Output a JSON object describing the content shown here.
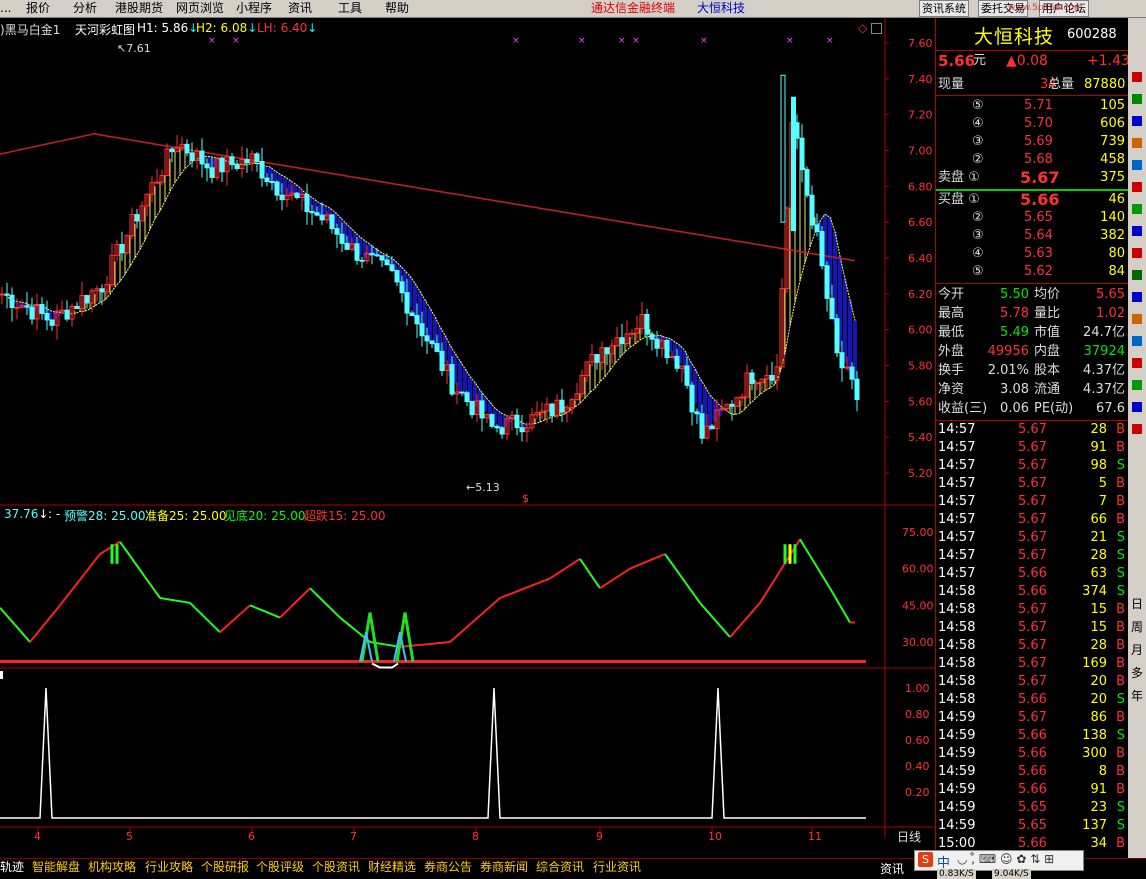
{
  "menu": {
    "items": [
      "报价",
      "分析",
      "港股期货",
      "网页浏览",
      "小程序",
      "资讯",
      "工具",
      "帮助"
    ],
    "promo1": "通达信金融终端",
    "promo2": "大恒科技",
    "buttons": [
      "资讯系统",
      "委托交易",
      "用户论坛"
    ],
    "site": "www.5p168.com"
  },
  "chart": {
    "indicator_name": "黑马白金1",
    "indicator2": "天河彩虹图",
    "h1": "H1: 5.86",
    "h2": "H2: 6.08",
    "lh": "LH: 6.40",
    "hi_label": "7.61",
    "lo_label": "5.13",
    "price_ticks": [
      "7.60",
      "7.40",
      "7.20",
      "7.00",
      "6.80",
      "6.60",
      "6.40",
      "6.20",
      "6.00",
      "5.80",
      "5.60",
      "5.40",
      "5.20"
    ],
    "osc_header": {
      "value": "37.76",
      "sep": ": -",
      "warn": "预警28: 25.00",
      "prep": "准备25: 25.00",
      "bottom": "见底20: 25.00",
      "oversold": "超跌15: 25.00"
    },
    "osc_ticks": [
      "75.00",
      "60.00",
      "45.00",
      "30.00"
    ],
    "sig_ticks": [
      "1.00",
      "0.80",
      "0.60",
      "0.40",
      "0.20"
    ],
    "x_ticks": [
      "4",
      "5",
      "6",
      "7",
      "8",
      "9",
      "10",
      "11"
    ],
    "period": "日线",
    "colors": {
      "up": "#ff3030",
      "down": "#54ffff",
      "ma": "#c81e1e",
      "band_bull": "#ffff66",
      "band_bear": "#1818c8"
    }
  },
  "quote": {
    "name": "大恒科技",
    "code": "600288",
    "price": "5.66",
    "price_unit": "元",
    "change": "▲0.08",
    "pct": "+1.43",
    "volume_label": "现量",
    "volume": "34",
    "total_label": "总量",
    "total": "87880",
    "asks": [
      {
        "lv": "⑤",
        "price": "5.71",
        "vol": "105"
      },
      {
        "lv": "④",
        "price": "5.70",
        "vol": "606"
      },
      {
        "lv": "③",
        "price": "5.69",
        "vol": "739"
      },
      {
        "lv": "②",
        "price": "5.68",
        "vol": "458"
      },
      {
        "lv": "卖盘 ①",
        "price": "5.67",
        "vol": "375"
      }
    ],
    "bids": [
      {
        "lv": "买盘 ①",
        "price": "5.66",
        "vol": "46"
      },
      {
        "lv": "②",
        "price": "5.65",
        "vol": "140"
      },
      {
        "lv": "③",
        "price": "5.64",
        "vol": "382"
      },
      {
        "lv": "④",
        "price": "5.63",
        "vol": "80"
      },
      {
        "lv": "⑤",
        "price": "5.62",
        "vol": "84"
      }
    ],
    "stats": [
      {
        "l1": "今开",
        "v1": "5.50",
        "l2": "均价",
        "v2": "5.65"
      },
      {
        "l1": "最高",
        "v1": "5.78",
        "l2": "量比",
        "v2": "1.02"
      },
      {
        "l1": "最低",
        "v1": "5.49",
        "l2": "市值",
        "v2": "24.7亿"
      },
      {
        "l1": "外盘",
        "v1": "49956",
        "l2": "内盘",
        "v2": "37924"
      },
      {
        "l1": "换手",
        "v1": "2.01%",
        "l2": "股本",
        "v2": "4.37亿"
      },
      {
        "l1": "净资",
        "v1": "3.08",
        "l2": "流通",
        "v2": "4.37亿"
      },
      {
        "l1": "收益(三)",
        "v1": "0.06",
        "l2": "PE(动)",
        "v2": "67.6"
      }
    ],
    "ticks": [
      {
        "t": "14:57",
        "p": "5.67",
        "v": "28",
        "s": "B"
      },
      {
        "t": "14:57",
        "p": "5.67",
        "v": "91",
        "s": "B"
      },
      {
        "t": "14:57",
        "p": "5.67",
        "v": "98",
        "s": "S"
      },
      {
        "t": "14:57",
        "p": "5.67",
        "v": "5",
        "s": "B"
      },
      {
        "t": "14:57",
        "p": "5.67",
        "v": "7",
        "s": "B"
      },
      {
        "t": "14:57",
        "p": "5.67",
        "v": "66",
        "s": "B"
      },
      {
        "t": "14:57",
        "p": "5.67",
        "v": "21",
        "s": "S"
      },
      {
        "t": "14:57",
        "p": "5.67",
        "v": "28",
        "s": "S"
      },
      {
        "t": "14:57",
        "p": "5.66",
        "v": "63",
        "s": "S"
      },
      {
        "t": "14:58",
        "p": "5.66",
        "v": "374",
        "s": "S"
      },
      {
        "t": "14:58",
        "p": "5.67",
        "v": "15",
        "s": "B"
      },
      {
        "t": "14:58",
        "p": "5.67",
        "v": "15",
        "s": "B"
      },
      {
        "t": "14:58",
        "p": "5.67",
        "v": "28",
        "s": "B"
      },
      {
        "t": "14:58",
        "p": "5.67",
        "v": "169",
        "s": "B"
      },
      {
        "t": "14:58",
        "p": "5.67",
        "v": "20",
        "s": "B"
      },
      {
        "t": "14:58",
        "p": "5.66",
        "v": "20",
        "s": "S"
      },
      {
        "t": "14:59",
        "p": "5.67",
        "v": "86",
        "s": "B"
      },
      {
        "t": "14:59",
        "p": "5.66",
        "v": "138",
        "s": "S"
      },
      {
        "t": "14:59",
        "p": "5.66",
        "v": "300",
        "s": "B"
      },
      {
        "t": "14:59",
        "p": "5.66",
        "v": "8",
        "s": "B"
      },
      {
        "t": "14:59",
        "p": "5.66",
        "v": "91",
        "s": "B"
      },
      {
        "t": "14:59",
        "p": "5.65",
        "v": "23",
        "s": "S"
      },
      {
        "t": "14:59",
        "p": "5.65",
        "v": "137",
        "s": "S"
      },
      {
        "t": "15:00",
        "p": "5.66",
        "v": "34",
        "s": "B"
      }
    ]
  },
  "bottom_tabs": [
    "轨迹",
    "智能解盘",
    "机构攻略",
    "行业攻略",
    "个股研报",
    "个股评级",
    "个股资讯",
    "财经精选",
    "券商公告",
    "券商新闻",
    "综合资讯",
    "行业资讯"
  ],
  "right_tools": [
    "日",
    "周",
    "月",
    "多",
    "年"
  ],
  "status": {
    "right_label": "资讯",
    "speed1": "0.83K/S",
    "speed2": "9.04K/S",
    "ime": "中"
  }
}
